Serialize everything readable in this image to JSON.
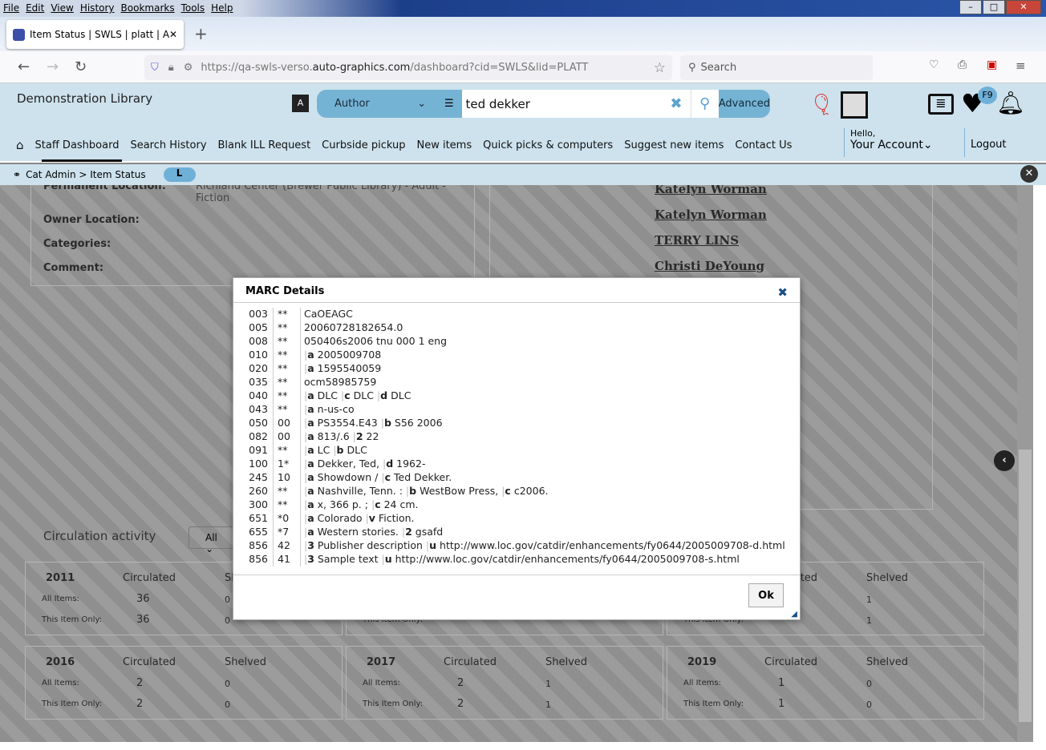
{
  "browser": {
    "menu": [
      "File",
      "Edit",
      "View",
      "History",
      "Bookmarks",
      "Tools",
      "Help"
    ],
    "tab_title": "Item Status | SWLS | platt | Auto-",
    "url_prefix": "https://qa-swls-verso.",
    "url_domain": "auto-graphics.com",
    "url_suffix": "/dashboard?cid=SWLS&lid=PLATT",
    "search_placeholder": "Search"
  },
  "header": {
    "library": "Demonstration Library",
    "search_type": "Author",
    "search_value": "ted dekker",
    "advanced": "Advanced",
    "badge": "F9",
    "hello": "Hello,",
    "account": "Your Account",
    "logout": "Logout"
  },
  "nav": [
    "Staff Dashboard",
    "Search History",
    "Blank ILL Request",
    "Curbside pickup",
    "New items",
    "Quick picks & computers",
    "Suggest new items",
    "Contact Us"
  ],
  "breadcrumb": {
    "path": "Cat Admin > Item Status",
    "badge": "L"
  },
  "item": {
    "perm_label": "Permanent Location:",
    "perm_value": "Richland Center (Brewer Public Library) - Adult - Fiction",
    "owner_label": "Owner Location:",
    "categories_label": "Categories:",
    "comment_label": "Comment:"
  },
  "names": [
    "Katelyn Worman",
    "Katelyn Worman",
    "TERRY LINS",
    "Christi DeYoung"
  ],
  "circulation": {
    "title": "Circulation activity",
    "filter": "All",
    "all_items": "All Items:",
    "this_item": "This Item Only:",
    "circulated": "Circulated",
    "shelved": "Shelved",
    "blocks": [
      {
        "year": "2011",
        "all": [
          "36",
          "0"
        ],
        "this": [
          "36",
          "0"
        ]
      },
      {
        "year": "",
        "all": [
          "",
          ""
        ],
        "this": [
          "",
          ""
        ]
      },
      {
        "year": "",
        "all": [
          "",
          "1"
        ],
        "this": [
          "",
          "1"
        ]
      },
      {
        "year": "2016",
        "all": [
          "2",
          "0"
        ],
        "this": [
          "2",
          "0"
        ]
      },
      {
        "year": "2017",
        "all": [
          "2",
          "1"
        ],
        "this": [
          "2",
          "1"
        ]
      },
      {
        "year": "2019",
        "all": [
          "1",
          "0"
        ],
        "this": [
          "1",
          "0"
        ]
      }
    ]
  },
  "modal": {
    "title": "MARC Details",
    "ok": "Ok",
    "rows": [
      [
        "003",
        "**",
        "CaOEAGC"
      ],
      [
        "005",
        "**",
        "20060728182654.0"
      ],
      [
        "008",
        "**",
        "050406s2006 tnu 000 1 eng"
      ],
      [
        "010",
        "**",
        "|a 2005009708"
      ],
      [
        "020",
        "**",
        "|a 1595540059"
      ],
      [
        "035",
        "**",
        "ocm58985759"
      ],
      [
        "040",
        "**",
        "|a DLC |c DLC |d DLC"
      ],
      [
        "043",
        "**",
        "|a n-us-co"
      ],
      [
        "050",
        "00",
        "|a PS3554.E43 |b S56 2006"
      ],
      [
        "082",
        "00",
        "|a 813/.6 |2 22"
      ],
      [
        "091",
        "**",
        "|a LC |b DLC"
      ],
      [
        "100",
        "1*",
        "|a Dekker, Ted, |d 1962-"
      ],
      [
        "245",
        "10",
        "|a Showdown / |c Ted Dekker."
      ],
      [
        "260",
        "**",
        "|a Nashville, Tenn. : |b WestBow Press, |c c2006."
      ],
      [
        "300",
        "**",
        "|a x, 366 p. ; |c 24 cm."
      ],
      [
        "651",
        "*0",
        "|a Colorado |v Fiction."
      ],
      [
        "655",
        "*7",
        "|a Western stories. |2 gsafd"
      ],
      [
        "856",
        "42",
        "|3 Publisher description |u http://www.loc.gov/catdir/enhancements/fy0644/2005009708-d.html"
      ],
      [
        "856",
        "41",
        "|3 Sample text |u http://www.loc.gov/catdir/enhancements/fy0644/2005009708-s.html"
      ]
    ]
  }
}
